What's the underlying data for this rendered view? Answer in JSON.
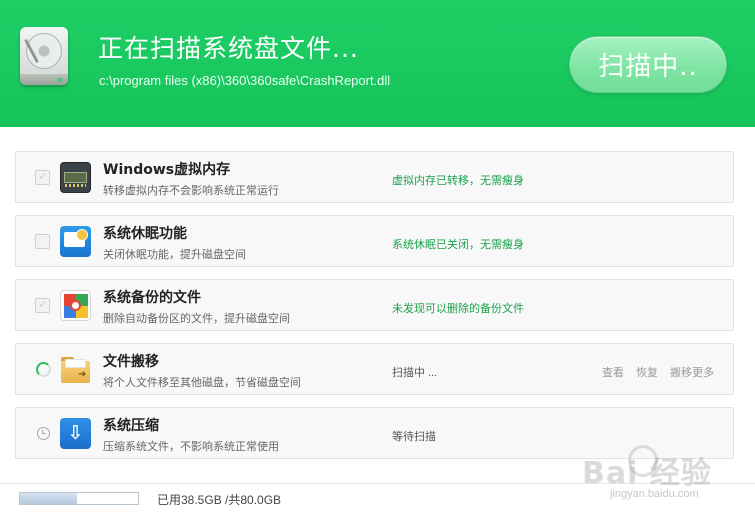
{
  "header": {
    "title": "正在扫描系统盘文件...",
    "path": "c:\\program files (x86)\\360\\360safe\\CrashReport.dll",
    "scan_button": "扫描中.."
  },
  "items": [
    {
      "title": "Windows虚拟内存",
      "desc": "转移虚拟内存不会影响系统正常运行",
      "status": "虚拟内存已转移，无需瘦身",
      "checked": true
    },
    {
      "title": "系统休眠功能",
      "desc": "关闭休眠功能，提升磁盘空间",
      "status": "系统休眠已关闭，无需瘦身",
      "checked": false
    },
    {
      "title": "系统备份的文件",
      "desc": "删除自动备份区的文件，提升磁盘空间",
      "status": "未发现可以删除的备份文件",
      "checked": true
    },
    {
      "title": "文件搬移",
      "desc": "将个人文件移至其他磁盘，节省磁盘空间",
      "status": "扫描中 ...",
      "actions": [
        "查看",
        "恢复",
        "搬移更多"
      ]
    },
    {
      "title": "系统压缩",
      "desc": "压缩系统文件，不影响系统正常使用",
      "status": "等待扫描"
    }
  ],
  "footer": {
    "disk_usage": "已用38.5GB /共80.0GB",
    "used_fraction": 0.48
  },
  "watermark": {
    "logo": "Bai 经验",
    "url": "jingyan.baidu.com"
  }
}
